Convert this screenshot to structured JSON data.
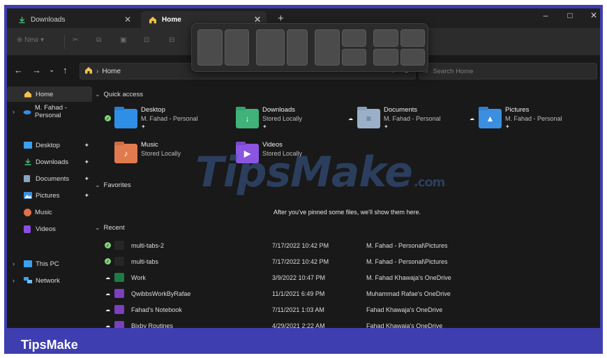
{
  "tabs": [
    {
      "label": "Downloads",
      "active": false
    },
    {
      "label": "Home",
      "active": true
    }
  ],
  "window_controls": {
    "minimize": "–",
    "maximize": "□",
    "close": "✕"
  },
  "new_tab": "+",
  "tab_close": "✕",
  "command_bar": {
    "new_label": "New",
    "new_icon": "plus-circle-icon"
  },
  "snap_layouts": {
    "groups": 4
  },
  "address": {
    "location": "Home",
    "separator": "›"
  },
  "nav": {
    "back": "←",
    "forward": "→",
    "recent": "⌄",
    "up": "↑"
  },
  "search": {
    "placeholder": "Search Home"
  },
  "sidebar": {
    "items": [
      {
        "label": "Home",
        "icon": "home-icon",
        "color": "#f2c14e",
        "selected": true
      },
      {
        "label": "M. Fahad - Personal",
        "icon": "onedrive-cloud-icon",
        "color": "#2f8fe6",
        "chevron": true
      },
      {
        "label": "Desktop",
        "icon": "desktop-folder-icon",
        "color": "#3aa0ef",
        "pinned": true
      },
      {
        "label": "Downloads",
        "icon": "download-arrow-icon",
        "color": "#3fc07a",
        "pinned": true
      },
      {
        "label": "Documents",
        "icon": "documents-icon",
        "color": "#8aa3c0",
        "pinned": true
      },
      {
        "label": "Pictures",
        "icon": "pictures-icon",
        "color": "#3b8fe0",
        "pinned": true
      },
      {
        "label": "Music",
        "icon": "music-icon",
        "color": "#e0704a"
      },
      {
        "label": "Videos",
        "icon": "videos-icon",
        "color": "#8a4fe0"
      },
      {
        "label": "This PC",
        "icon": "this-pc-icon",
        "color": "#3aa0ef",
        "chevron": true
      },
      {
        "label": "Network",
        "icon": "network-icon",
        "color": "#3aa0ef",
        "chevron": true
      }
    ]
  },
  "quick_access": {
    "title": "Quick access",
    "items": [
      {
        "name": "Desktop",
        "sub": "M. Fahad - Personal",
        "pinned": true,
        "status": "synced",
        "color": "#2f8fe6"
      },
      {
        "name": "Downloads",
        "sub": "Stored Locally",
        "pinned": true,
        "status": "none",
        "color": "#3fb37a"
      },
      {
        "name": "Documents",
        "sub": "M. Fahad - Personal",
        "pinned": true,
        "status": "cloud",
        "color": "#9bb0c8"
      },
      {
        "name": "Pictures",
        "sub": "M. Fahad - Personal",
        "pinned": true,
        "status": "cloud",
        "color": "#3b8fe0"
      },
      {
        "name": "Music",
        "sub": "Stored Locally",
        "pinned": false,
        "status": "none",
        "color": "#e07a4f"
      },
      {
        "name": "Videos",
        "sub": "Stored Locally",
        "pinned": false,
        "status": "none",
        "color": "#8a55e0"
      }
    ]
  },
  "favorites": {
    "title": "Favorites",
    "empty_message": "After you've pinned some files, we'll show them here."
  },
  "recent": {
    "title": "Recent",
    "rows": [
      {
        "name": "multi-tabs-2",
        "date": "7/17/2022 10:42 PM",
        "location": "M. Fahad - Personal\\Pictures",
        "status": "synced",
        "icon": "image-file-icon"
      },
      {
        "name": "multi-tabs",
        "date": "7/17/2022 10:42 PM",
        "location": "M. Fahad - Personal\\Pictures",
        "status": "synced",
        "icon": "image-file-icon"
      },
      {
        "name": "Work",
        "date": "3/9/2022 10:47 PM",
        "location": "M. Fahad Khawaja's OneDrive",
        "status": "cloud",
        "icon": "excel-file-icon"
      },
      {
        "name": "QwibbsWorkByRafae",
        "date": "11/1/2021 6:49 PM",
        "location": "Muhammad Rafae's OneDrive",
        "status": "cloud",
        "icon": "onenote-file-icon"
      },
      {
        "name": "Fahad's Notebook",
        "date": "7/11/2021 1:03 AM",
        "location": "Fahad Khawaja's OneDrive",
        "status": "cloud",
        "icon": "onenote-file-icon"
      },
      {
        "name": "Bixby Routines",
        "date": "4/29/2021 2:22 AM",
        "location": "Fahad Khawaja's OneDrive",
        "status": "cloud",
        "icon": "onenote-file-icon"
      }
    ]
  },
  "watermark": {
    "main": "TipsMake",
    "suffix": ".com"
  },
  "footer": {
    "brand": "TipsMake"
  }
}
